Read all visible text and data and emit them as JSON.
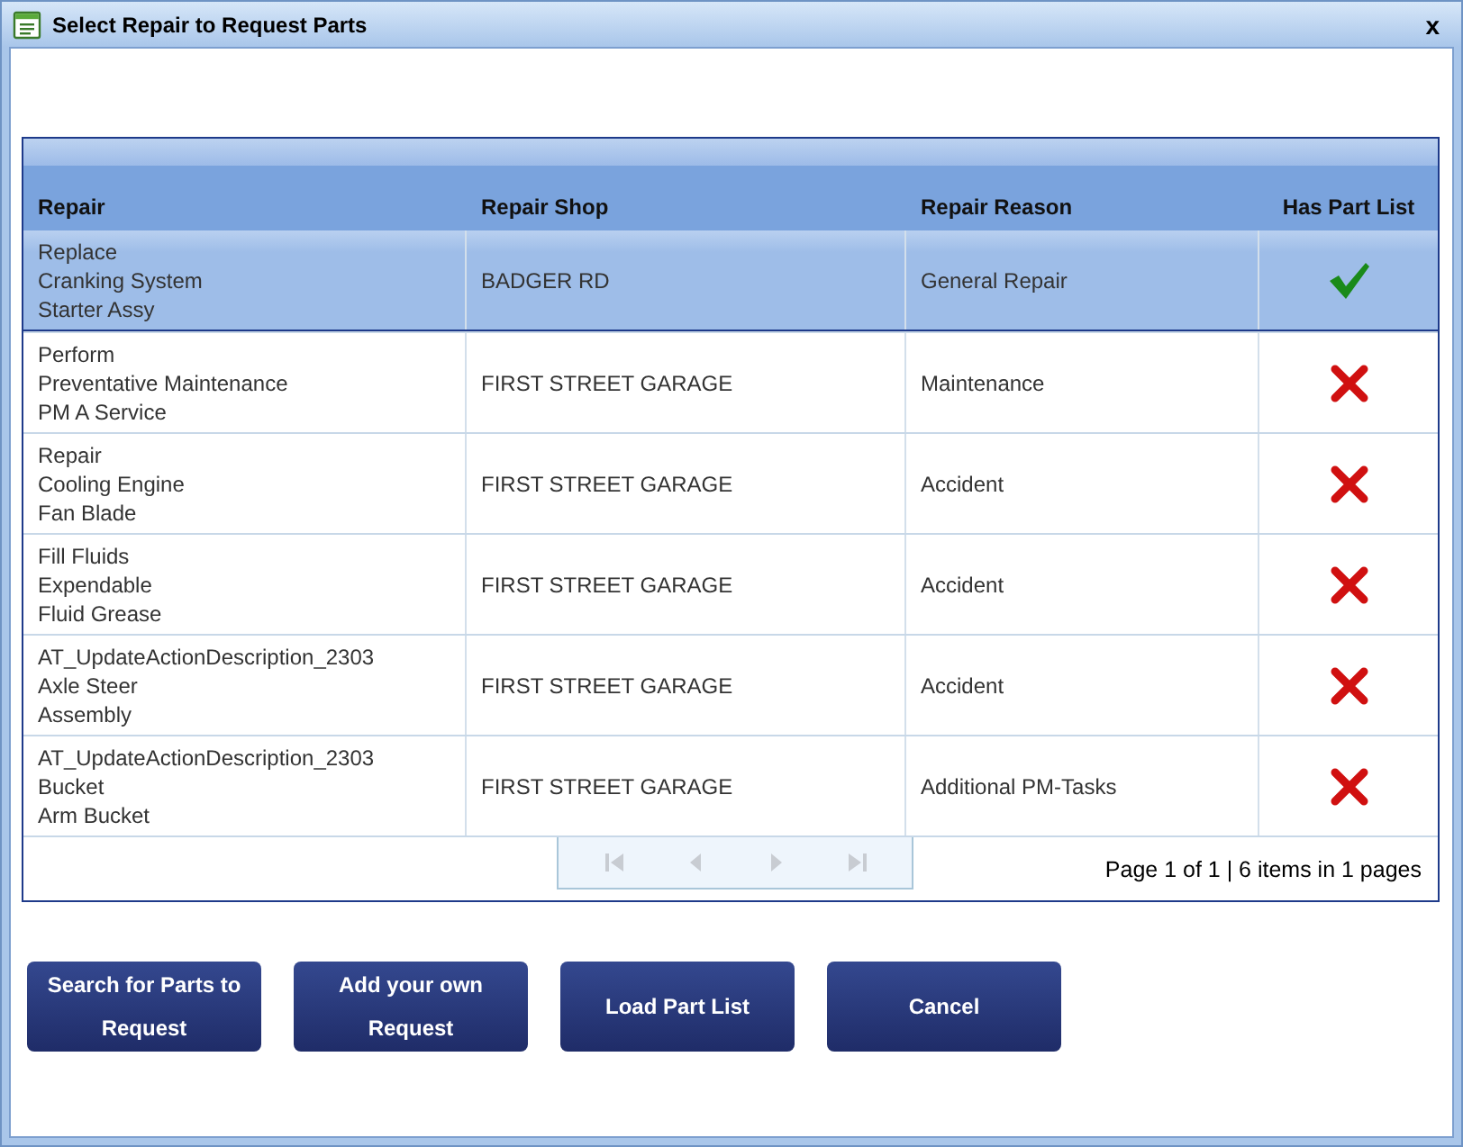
{
  "window": {
    "title": "Select Repair to Request Parts",
    "close": "x"
  },
  "table": {
    "columns": [
      "Repair",
      "Repair Shop",
      "Repair Reason",
      "Has Part List"
    ],
    "rows": [
      {
        "repair": [
          "Replace",
          "Cranking System",
          "Starter Assy"
        ],
        "shop": "BADGER RD",
        "reason": "General Repair",
        "has_part_list": true,
        "selected": true
      },
      {
        "repair": [
          "Perform",
          "Preventative Maintenance",
          "PM A Service"
        ],
        "shop": "FIRST STREET GARAGE",
        "reason": "Maintenance",
        "has_part_list": false,
        "selected": false
      },
      {
        "repair": [
          "Repair",
          "Cooling Engine",
          "Fan Blade"
        ],
        "shop": "FIRST STREET GARAGE",
        "reason": "Accident",
        "has_part_list": false,
        "selected": false
      },
      {
        "repair": [
          "Fill Fluids",
          "Expendable",
          "Fluid Grease"
        ],
        "shop": "FIRST STREET GARAGE",
        "reason": "Accident",
        "has_part_list": false,
        "selected": false
      },
      {
        "repair": [
          "AT_UpdateActionDescription_2303",
          "Axle Steer",
          "Assembly"
        ],
        "shop": "FIRST STREET GARAGE",
        "reason": "Accident",
        "has_part_list": false,
        "selected": false
      },
      {
        "repair": [
          "AT_UpdateActionDescription_2303",
          "Bucket",
          "Arm Bucket"
        ],
        "shop": "FIRST STREET GARAGE",
        "reason": "Additional PM-Tasks",
        "has_part_list": false,
        "selected": false
      }
    ],
    "pager": {
      "disabled": true,
      "summary": "Page 1 of 1 | 6 items in 1 pages"
    }
  },
  "buttons": [
    {
      "label": "Search for Parts to Request"
    },
    {
      "label": "Add your own Request"
    },
    {
      "label": "Load Part List"
    },
    {
      "label": "Cancel"
    }
  ]
}
